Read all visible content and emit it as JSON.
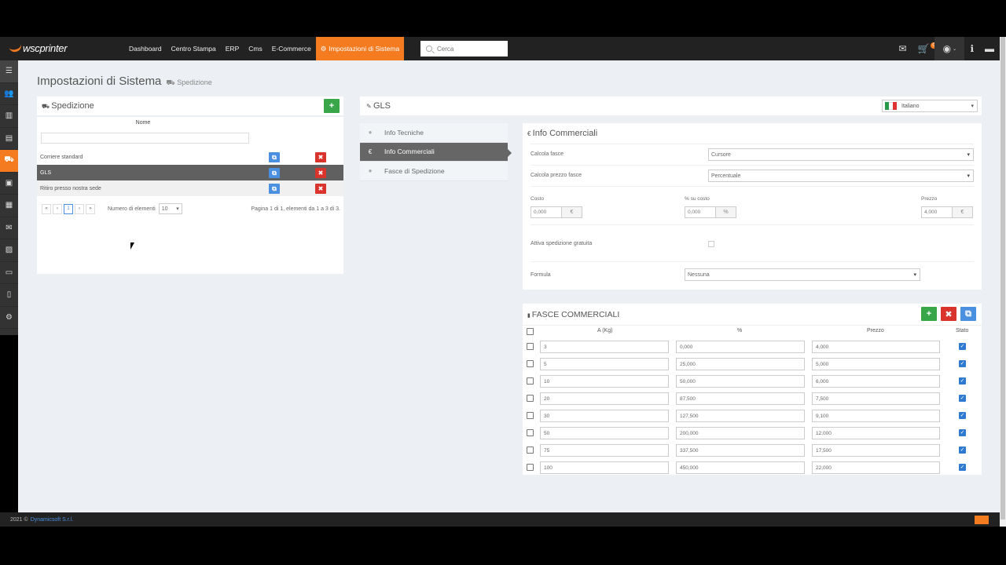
{
  "brand": {
    "logo_text": "wscprinter"
  },
  "nav": {
    "items": [
      "Dashboard",
      "Centro Stampa",
      "ERP",
      "Cms",
      "E-Commerce"
    ],
    "active": "Impostazioni di Sistema",
    "search_placeholder": "Cerca"
  },
  "topbar": {
    "cart_badge": "0"
  },
  "page": {
    "title": "Impostazioni di Sistema",
    "subtitle": "Spedizione"
  },
  "spedizione": {
    "title": "Spedizione",
    "col_name": "Nome",
    "rows": [
      {
        "name": "Corriere standard"
      },
      {
        "name": "GLS"
      },
      {
        "name": "Ritiro presso nostra sede"
      }
    ],
    "pager": {
      "pages": [
        "«",
        "‹",
        "1",
        "›",
        "»"
      ],
      "per_page_label": "Numero di elementi",
      "per_page_value": "10",
      "info": "Pagina 1 di 1, elementi da 1 a 3 di 3."
    }
  },
  "gls": {
    "title": "GLS",
    "language": "Italiano"
  },
  "tabs": [
    {
      "label": "Info Tecniche",
      "icon": "info-icon"
    },
    {
      "label": "Info Commerciali",
      "icon": "euro-icon"
    },
    {
      "label": "Fasce di Spedizione",
      "icon": "info-icon"
    }
  ],
  "info_commerciali": {
    "title": "Info Commerciali",
    "calcola_fasce_label": "Calcola fasce",
    "calcola_fasce_value": "Cursore",
    "calcola_prezzo_label": "Calcola prezzo fasce",
    "calcola_prezzo_value": "Percentuale",
    "costo_label": "Costo",
    "costo_value": "0,000",
    "costo_addon": "€",
    "perc_label": "% su costo",
    "perc_value": "0,000",
    "perc_addon": "%",
    "prezzo_label": "Prezzo",
    "prezzo_value": "4,000",
    "prezzo_addon": "€",
    "gratuita_label": "Attiva spedizione gratuita",
    "formula_label": "Formula",
    "formula_value": "Nessuna"
  },
  "fasce": {
    "title": "FASCE COMMERCIALI",
    "headers": {
      "a": "A (Kg)",
      "perc": "%",
      "prezzo": "Prezzo",
      "stato": "Stato"
    },
    "rows": [
      {
        "a": "3",
        "perc": "0,000",
        "prezzo": "4,000"
      },
      {
        "a": "5",
        "perc": "25,000",
        "prezzo": "5,000"
      },
      {
        "a": "10",
        "perc": "50,000",
        "prezzo": "6,000"
      },
      {
        "a": "20",
        "perc": "87,500",
        "prezzo": "7,500"
      },
      {
        "a": "30",
        "perc": "127,500",
        "prezzo": "9,100"
      },
      {
        "a": "50",
        "perc": "200,000",
        "prezzo": "12,000"
      },
      {
        "a": "75",
        "perc": "337,500",
        "prezzo": "17,500"
      },
      {
        "a": "100",
        "perc": "450,000",
        "prezzo": "22,000"
      }
    ]
  },
  "footer": {
    "year": "2021 ©",
    "company": "Dynamicsoft S.r.l."
  },
  "colors": {
    "accent": "#f47b20",
    "blue": "#4b8fe0",
    "green": "#3aa64a",
    "red": "#d9342b"
  }
}
